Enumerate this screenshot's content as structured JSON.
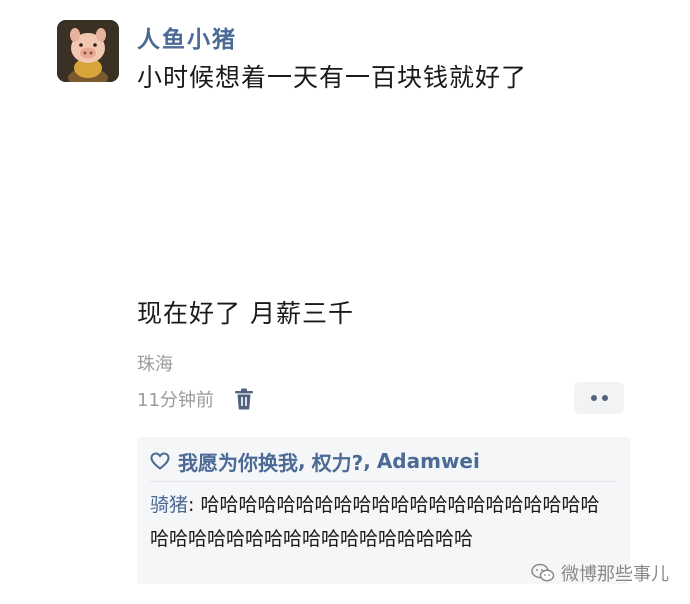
{
  "post": {
    "author": "人鱼小猪",
    "text_line1": "小时候想着一天有一百块钱就好了",
    "text_line2": "现在好了 月薪三千",
    "location": "珠海",
    "time": "11分钟前"
  },
  "icons": {
    "delete": "trash-icon",
    "more": "more-dots-icon",
    "like": "heart-outline-icon",
    "watermark": "wechat-icon"
  },
  "likes": {
    "names": [
      "我愿为你换我",
      "权力?",
      "Adamwei"
    ],
    "separator": ","
  },
  "comment": {
    "commenter": "骑猪",
    "colon": ":",
    "text": "哈哈哈哈哈哈哈哈哈哈哈哈哈哈哈哈哈哈哈哈哈哈哈哈哈哈哈哈哈哈哈哈哈哈哈哈哈哈"
  },
  "watermark": {
    "text": "微博那些事儿"
  },
  "colors": {
    "link": "#4b6a95",
    "muted": "#9b9b9b",
    "comment_bg": "#f5f6f8"
  }
}
